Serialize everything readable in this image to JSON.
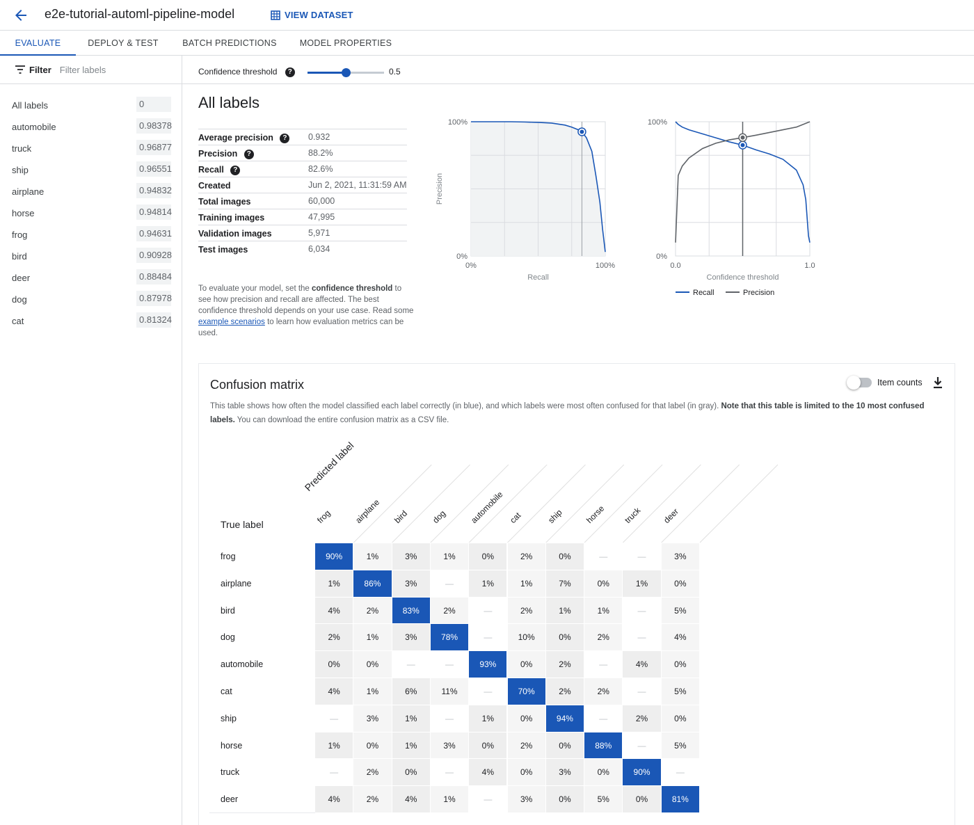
{
  "header": {
    "title": "e2e-tutorial-automl-pipeline-model",
    "view_dataset": "VIEW DATASET"
  },
  "tabs": [
    {
      "label": "EVALUATE",
      "active": true
    },
    {
      "label": "DEPLOY & TEST"
    },
    {
      "label": "BATCH PREDICTIONS"
    },
    {
      "label": "MODEL PROPERTIES"
    }
  ],
  "sidebar": {
    "filter_label": "Filter",
    "filter_placeholder": "Filter labels",
    "labels": [
      {
        "name": "All labels",
        "value": "0"
      },
      {
        "name": "automobile",
        "value": "0.98378"
      },
      {
        "name": "truck",
        "value": "0.96877"
      },
      {
        "name": "ship",
        "value": "0.96551"
      },
      {
        "name": "airplane",
        "value": "0.94832"
      },
      {
        "name": "horse",
        "value": "0.94814"
      },
      {
        "name": "frog",
        "value": "0.94631"
      },
      {
        "name": "bird",
        "value": "0.90928"
      },
      {
        "name": "deer",
        "value": "0.88484"
      },
      {
        "name": "dog",
        "value": "0.87978"
      },
      {
        "name": "cat",
        "value": "0.81324"
      }
    ]
  },
  "threshold": {
    "label": "Confidence threshold",
    "value": "0.5",
    "fraction": 0.5
  },
  "main": {
    "heading": "All labels",
    "metrics": [
      {
        "key": "Average precision",
        "value": "0.932",
        "help": true
      },
      {
        "key": "Precision",
        "value": "88.2%",
        "help": true
      },
      {
        "key": "Recall",
        "value": "82.6%",
        "help": true
      },
      {
        "key": "Created",
        "value": "Jun 2, 2021, 11:31:59 AM"
      },
      {
        "key": "Total images",
        "value": "60,000"
      },
      {
        "key": "Training images",
        "value": "47,995"
      },
      {
        "key": "Validation images",
        "value": "5,971"
      },
      {
        "key": "Test images",
        "value": "6,034"
      }
    ],
    "explain": {
      "p1": "To evaluate your model, set the ",
      "b1": "confidence threshold",
      "p2": " to see how precision and recall are affected. The best confidence threshold depends on your use case. Read some ",
      "link": "example scenarios",
      "p3": " to learn how evaluation metrics can be used."
    }
  },
  "chart_data": [
    {
      "type": "area",
      "xlabel": "Recall",
      "ylabel": "Precision",
      "xticks": [
        "0%",
        "100%"
      ],
      "yticks": [
        "0%",
        "100%"
      ],
      "x": [
        0,
        0.1,
        0.2,
        0.3,
        0.4,
        0.5,
        0.6,
        0.7,
        0.75,
        0.8,
        0.826,
        0.86,
        0.9,
        0.93,
        0.96,
        0.98,
        1.0
      ],
      "y": [
        1.0,
        1.0,
        1.0,
        1.0,
        0.998,
        0.995,
        0.99,
        0.975,
        0.96,
        0.94,
        0.925,
        0.88,
        0.78,
        0.6,
        0.4,
        0.2,
        0.03
      ],
      "marker": {
        "x": 0.826,
        "y": 0.925
      }
    },
    {
      "type": "line",
      "xlabel": "Confidence threshold",
      "xticks": [
        "0.0",
        "1.0"
      ],
      "yticks": [
        "0%",
        "100%"
      ],
      "series": [
        {
          "name": "Recall",
          "color": "#1a57b6",
          "x": [
            0,
            0.02,
            0.05,
            0.1,
            0.2,
            0.3,
            0.4,
            0.5,
            0.6,
            0.7,
            0.8,
            0.9,
            0.95,
            0.97,
            0.99,
            1.0
          ],
          "y": [
            1.0,
            0.98,
            0.96,
            0.94,
            0.91,
            0.88,
            0.85,
            0.826,
            0.79,
            0.76,
            0.72,
            0.64,
            0.53,
            0.42,
            0.15,
            0.1
          ]
        },
        {
          "name": "Precision",
          "color": "#5f6368",
          "x": [
            0,
            0.02,
            0.05,
            0.1,
            0.2,
            0.3,
            0.4,
            0.5,
            0.6,
            0.7,
            0.8,
            0.9,
            0.95,
            1.0
          ],
          "y": [
            0.1,
            0.6,
            0.67,
            0.73,
            0.8,
            0.84,
            0.865,
            0.882,
            0.9,
            0.92,
            0.94,
            0.96,
            0.98,
            1.0
          ]
        }
      ],
      "marker_x": 0.5
    }
  ],
  "confusion": {
    "title": "Confusion matrix",
    "toggle_label": "Item counts",
    "desc_a": "This table shows how often the model classified each label correctly (in blue), and which labels were most often confused for that label (in gray). ",
    "desc_b": "Note that this table is limited to the 10 most confused labels.",
    "desc_c": " You can download the entire confusion matrix as a CSV file.",
    "true_label": "True label",
    "predicted_label": "Predicted label",
    "columns": [
      "frog",
      "airplane",
      "bird",
      "dog",
      "automobile",
      "cat",
      "ship",
      "horse",
      "truck",
      "deer"
    ],
    "rows": [
      {
        "label": "frog",
        "cells": [
          "90%",
          "1%",
          "3%",
          "1%",
          "0%",
          "2%",
          "0%",
          "—",
          "—",
          "3%"
        ]
      },
      {
        "label": "airplane",
        "cells": [
          "1%",
          "86%",
          "3%",
          "—",
          "1%",
          "1%",
          "7%",
          "0%",
          "1%",
          "0%"
        ]
      },
      {
        "label": "bird",
        "cells": [
          "4%",
          "2%",
          "83%",
          "2%",
          "—",
          "2%",
          "1%",
          "1%",
          "—",
          "5%"
        ]
      },
      {
        "label": "dog",
        "cells": [
          "2%",
          "1%",
          "3%",
          "78%",
          "—",
          "10%",
          "0%",
          "2%",
          "—",
          "4%"
        ]
      },
      {
        "label": "automobile",
        "cells": [
          "0%",
          "0%",
          "—",
          "—",
          "93%",
          "0%",
          "2%",
          "—",
          "4%",
          "0%"
        ]
      },
      {
        "label": "cat",
        "cells": [
          "4%",
          "1%",
          "6%",
          "11%",
          "—",
          "70%",
          "2%",
          "2%",
          "—",
          "5%"
        ]
      },
      {
        "label": "ship",
        "cells": [
          "—",
          "3%",
          "1%",
          "—",
          "1%",
          "0%",
          "94%",
          "—",
          "2%",
          "0%"
        ]
      },
      {
        "label": "horse",
        "cells": [
          "1%",
          "0%",
          "1%",
          "3%",
          "0%",
          "2%",
          "0%",
          "88%",
          "—",
          "5%"
        ]
      },
      {
        "label": "truck",
        "cells": [
          "—",
          "2%",
          "0%",
          "—",
          "4%",
          "0%",
          "3%",
          "0%",
          "90%",
          "—"
        ]
      },
      {
        "label": "deer",
        "cells": [
          "4%",
          "2%",
          "4%",
          "1%",
          "—",
          "3%",
          "0%",
          "5%",
          "0%",
          "81%"
        ]
      }
    ],
    "colors": {
      "diagonal": "#1a57b6",
      "offdiag": "#eeeeee",
      "offdiag_alt": "#f5f5f5",
      "empty": "#ffffff"
    }
  }
}
